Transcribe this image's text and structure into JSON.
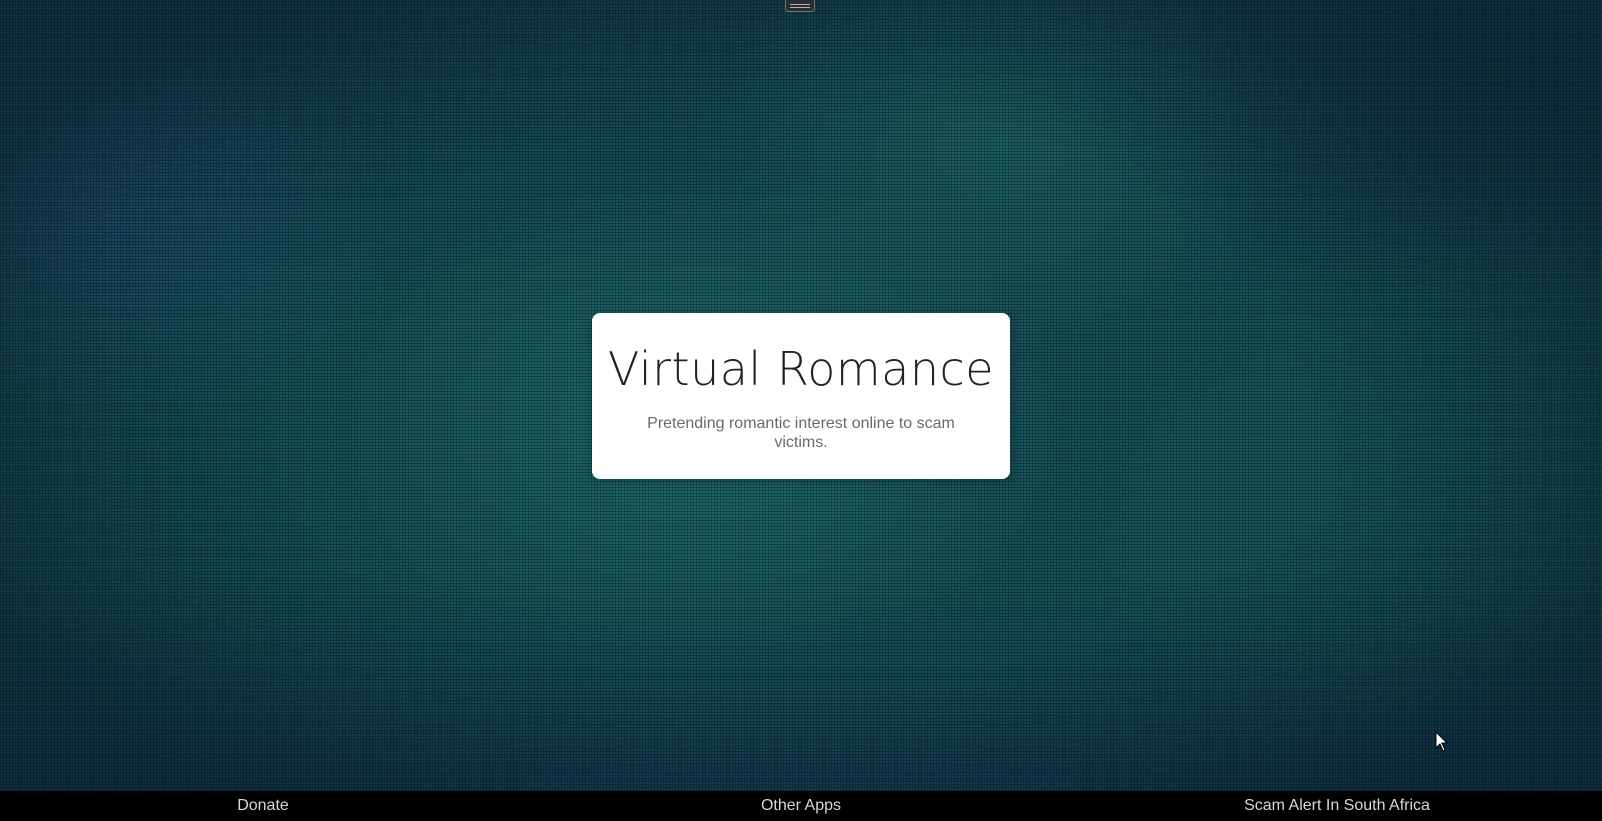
{
  "menu_handle": {
    "icon": "hamburger-icon"
  },
  "card": {
    "title": "Virtual Romance",
    "subtitle": "Pretending romantic interest online to scam victims."
  },
  "footer": {
    "links": [
      {
        "label": "Donate"
      },
      {
        "label": "Other Apps"
      },
      {
        "label": "Scam Alert In South Africa"
      }
    ]
  },
  "colors": {
    "background_teal": "#16545a",
    "background_blue": "#15465a",
    "card_background": "#ffffff",
    "title_color": "#222222",
    "subtitle_color": "#6a6a6a",
    "footer_background": "#000000",
    "footer_text": "#d8d8d8"
  }
}
